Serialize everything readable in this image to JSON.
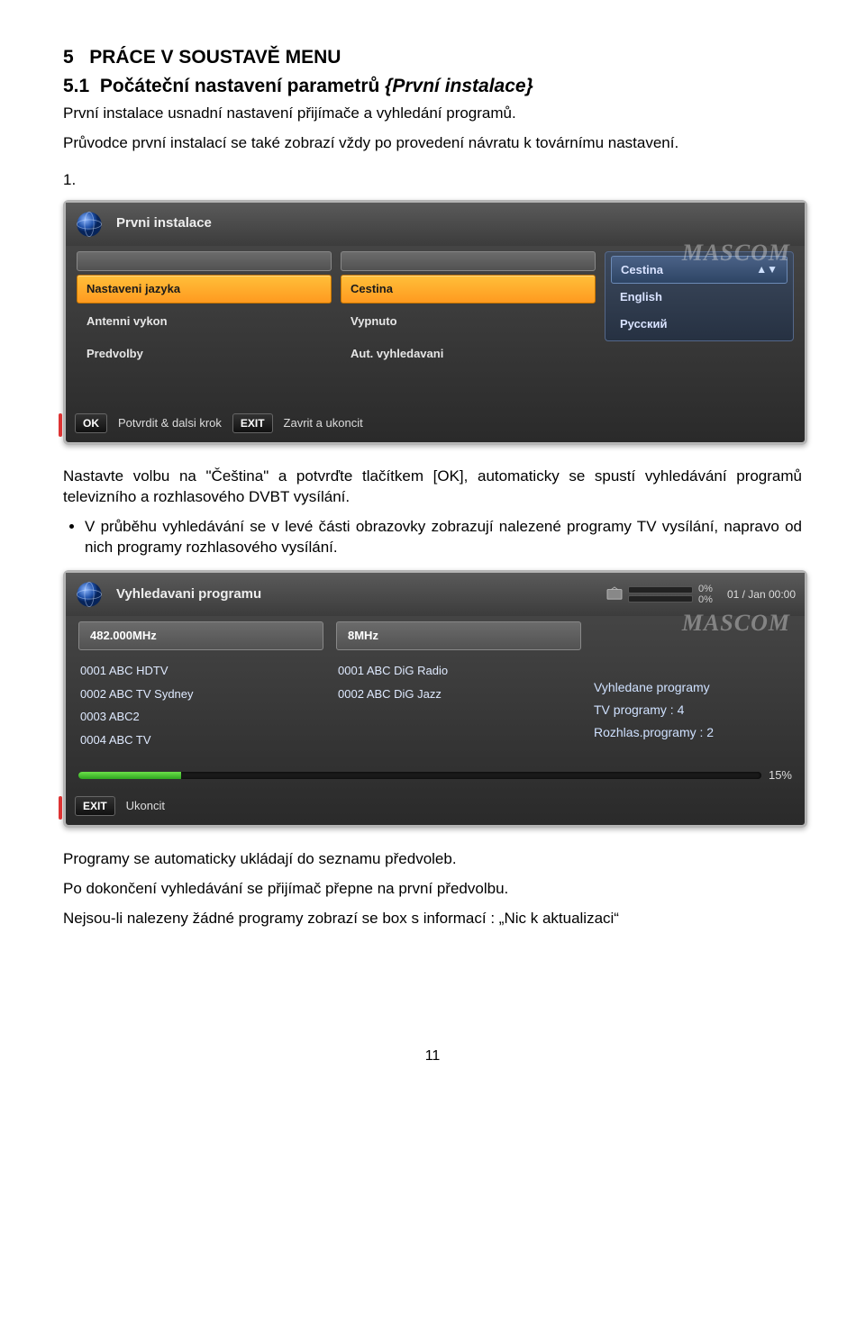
{
  "section_num": "5",
  "section_title": "PRÁCE V SOUSTAVĚ MENU",
  "subsection_num": "5.1",
  "subsection_title_prefix": "Počáteční nastavení parametrů ",
  "subsection_title_italic": "{První instalace}",
  "intro_p1": "První instalace usnadní nastavení přijímače a vyhledání programů.",
  "intro_p2": "Průvodce první instalací se také zobrazí vždy po provedení návratu k továrnímu nastavení.",
  "marker_1": "1.",
  "installer": {
    "title": "Prvni instalace",
    "watermark": "MASCOM",
    "left_items": [
      "Nastaveni jazyka",
      "Antenni vykon",
      "Predvolby"
    ],
    "right_items": [
      "Cestina",
      "Vypnuto",
      "Aut. vyhledavani"
    ],
    "side_items": [
      "Cestina",
      "English",
      "Русский"
    ],
    "foot_ok_key": "OK",
    "foot_ok_label": "Potvrdit & dalsi krok",
    "foot_exit_key": "EXIT",
    "foot_exit_label": "Zavrit a ukoncit"
  },
  "mid_p": "Nastavte volbu na \"Čeština\" a potvrďte tlačítkem [OK], automaticky se spustí vyhledávání programů televizního a rozhlasového DVBT vysílání.",
  "bullet_1": "V průběhu vyhledávání se v levé části obrazovky zobrazují nalezené programy TV vysílání, napravo od nich programy rozhlasového vysílání.",
  "scan": {
    "title": "Vyhledavani programu",
    "watermark": "MASCOM",
    "pct_a": "0%",
    "pct_b": "0%",
    "clock": "01 / Jan 00:00",
    "freq": "482.000MHz",
    "bw": "8MHz",
    "tv_list": [
      "0001 ABC HDTV",
      "0002 ABC TV Sydney",
      "0003 ABC2",
      "0004 ABC TV"
    ],
    "radio_list": [
      "0001 ABC DiG Radio",
      "0002 ABC DiG Jazz"
    ],
    "summary_title": "Vyhledane programy",
    "summary_tv": "TV programy : 4",
    "summary_radio": "Rozhlas.programy : 2",
    "progress_pct": "15%",
    "foot_exit_key": "EXIT",
    "foot_exit_label": "Ukoncit"
  },
  "after_p1": "Programy se automaticky ukládají do seznamu předvoleb.",
  "after_p2": "Po dokončení vyhledávání se přijímač přepne na první předvolbu.",
  "after_p3": "Nejsou-li nalezeny žádné programy zobrazí se box s informací : „Nic k aktualizaci“",
  "page_number": "11"
}
